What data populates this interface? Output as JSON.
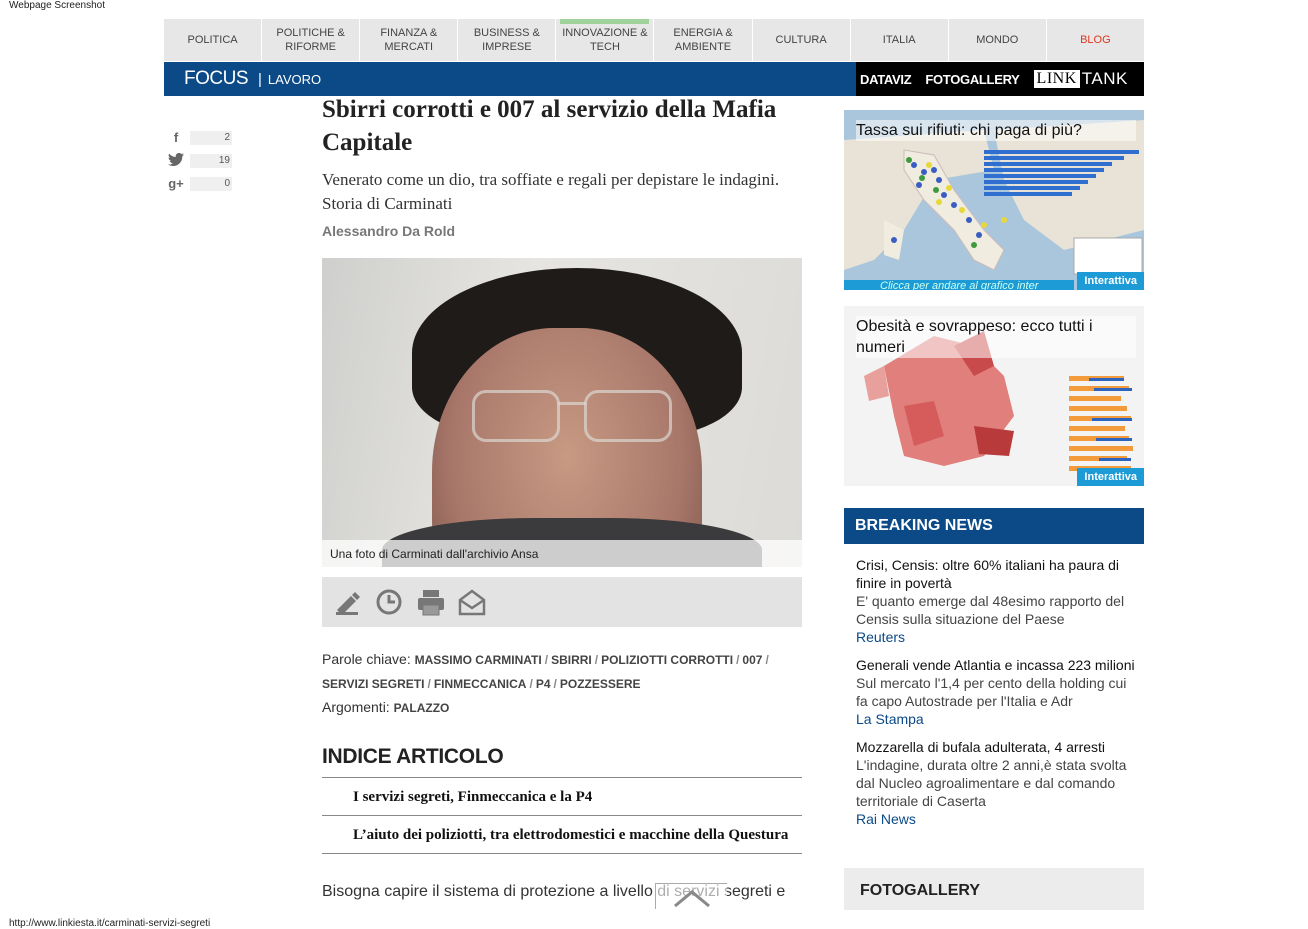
{
  "captions": {
    "top": "Webpage Screenshot",
    "bottom": "http://www.linkiesta.it/carminati-servizi-segreti"
  },
  "nav": {
    "items": [
      {
        "label": "POLITICA"
      },
      {
        "label": "POLITICHE &\nRIFORME"
      },
      {
        "label": "FINANZA &\nMERCATI"
      },
      {
        "label": "BUSINESS &\nIMPRESE"
      },
      {
        "label": "INNOVAZIONE &\nTECH"
      },
      {
        "label": "ENERGIA &\nAMBIENTE"
      },
      {
        "label": "CULTURA"
      },
      {
        "label": "ITALIA"
      },
      {
        "label": "MONDO"
      },
      {
        "label": "BLOG"
      }
    ]
  },
  "focusbar": {
    "label": "FOCUS",
    "sep": "|",
    "sub": "LAVORO",
    "dataviz": "DATAVIZ",
    "fotogallery": "FOTOGALLERY",
    "link": "LINK",
    "tank": "TANK"
  },
  "social": {
    "facebook": "2",
    "twitter": "19",
    "gplus": "0"
  },
  "article": {
    "title": "Sbirri corrotti e 007 al servizio della Mafia Capitale",
    "subtitle": "Venerato come un dio, tra soffiate e regali per depistare le indagini. Storia di Carminati",
    "author": "Alessandro Da Rold",
    "photo_caption": "Una foto di Carminati dall'archivio Ansa",
    "keywords_label": "Parole chiave:",
    "keywords": [
      "MASSIMO CARMINATI",
      "SBIRRI",
      "POLIZIOTTI CORROTTI",
      "007",
      "SERVIZI SEGRETI",
      "FINMECCANICA",
      "P4",
      "POZZESSERE"
    ],
    "topics_label": "Argomenti:",
    "topic": "PALAZZO",
    "index_title": "INDICE ARTICOLO",
    "index_items": [
      "I servizi segreti, Finmeccanica e la P4",
      "L’aiuto dei poliziotti, tra elettrodomestici e macchine della Questura"
    ],
    "body_start": "Bisogna capire il sistema di protezione a livello di servizi segreti e"
  },
  "sidebar": {
    "card1": {
      "title": "Tassa sui rifiuti: chi paga di più?",
      "badge": "Interattiva",
      "foot": "Clicca per andare al grafico inter"
    },
    "card2": {
      "title": "Obesità e sovrappeso: ecco tutti i numeri",
      "badge": "Interattiva"
    },
    "breaking_title": "BREAKING NEWS",
    "breaking": [
      {
        "title": "Crisi, Censis: oltre 60% italiani ha paura di finire in povertà",
        "desc": "E' quanto emerge dal 48esimo rapporto del Censis sulla situazione del Paese",
        "source": "Reuters"
      },
      {
        "title": "Generali vende Atlantia e incassa 223 milioni",
        "desc": "Sul mercato l'1,4 per cento della holding cui fa capo Autostrade per l'Italia e Adr",
        "source": "La Stampa"
      },
      {
        "title": "Mozzarella di bufala adulterata, 4 arresti",
        "desc": "L'indagine, durata oltre 2 anni,è stata svolta dal Nucleo agroalimentare e dal comando territoriale di Caserta",
        "source": "Rai News"
      }
    ],
    "fotogallery_title": "FOTOGALLERY"
  },
  "colors": {
    "brand_blue": "#0b4a87",
    "blog_red": "#e0351f",
    "badge_blue": "#1d9bd6"
  }
}
